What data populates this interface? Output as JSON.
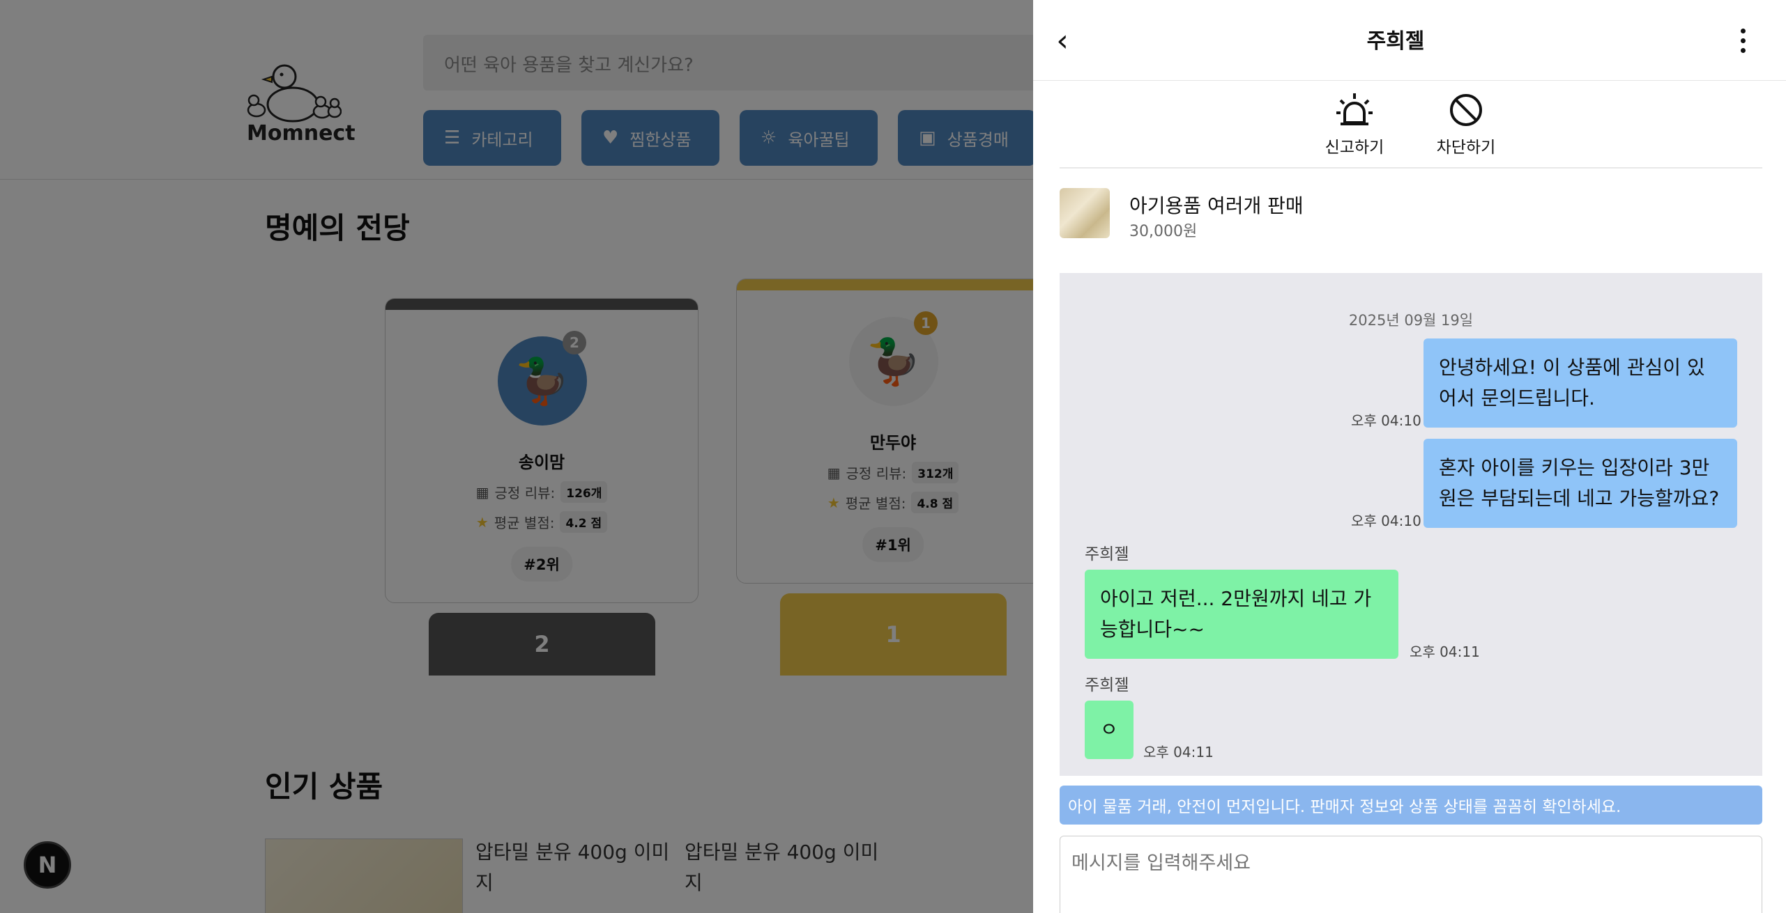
{
  "background": {
    "logo_text": "Momnect",
    "search_placeholder": "어떤 육아 용품을 찾고 계신가요?",
    "nav": [
      {
        "label": "카테고리",
        "icon": "menu-icon"
      },
      {
        "label": "찜한상품",
        "icon": "heart-icon"
      },
      {
        "label": "육아꿀팁",
        "icon": "lightbulb-icon"
      },
      {
        "label": "상품경매",
        "icon": "bag-icon"
      }
    ],
    "hall_of_fame_title": "명예의 전당",
    "rank2": {
      "medal": "2",
      "name": "송이맘",
      "review_label": "긍정 리뷰:",
      "review_count": "126개",
      "rating_label": "평균 별점:",
      "rating": "4.2 점",
      "badge": "#2위",
      "podium": "2"
    },
    "rank1": {
      "medal": "1",
      "name": "만두야",
      "review_label": "긍정 리뷰:",
      "review_count": "312개",
      "rating_label": "평균 별점:",
      "rating": "4.8 점",
      "badge": "#1위",
      "podium": "1"
    },
    "popular_title": "인기 상품",
    "products": [
      {
        "alt": "압타밀 분유 400g 이미지"
      },
      {
        "alt": "압타밀 분유 400g 이미지"
      }
    ],
    "next_badge": "N"
  },
  "chat": {
    "title": "주희젤",
    "actions": [
      {
        "label": "신고하기",
        "icon": "siren-icon"
      },
      {
        "label": "차단하기",
        "icon": "block-icon"
      }
    ],
    "product": {
      "title": "아기용품 여러개 판매",
      "price": "30,000원"
    },
    "date": "2025년 09월 19일",
    "messages": [
      {
        "from": "me",
        "text": "안녕하세요! 이 상품에 관심이 있어서 문의드립니다.",
        "time": "오후 04:10"
      },
      {
        "from": "me",
        "text": "혼자 아이를 키우는 입장이라 3만원은 부담되는데 네고 가능할까요?",
        "time": "오후 04:10"
      },
      {
        "from": "them",
        "sender": "주희젤",
        "text": "아이고 저런... 2만원까지 네고 가능합니다~~",
        "time": "오후 04:11"
      },
      {
        "from": "them",
        "sender": "주희젤",
        "text": "ㅇ",
        "time": "오후 04:11"
      }
    ],
    "notice": "아이 물품 거래, 안전이 먼저입니다. 판매자 정보와 상품 상태를 꼼꼼히 확인하세요.",
    "input_placeholder": "메시지를 입력해주세요"
  }
}
